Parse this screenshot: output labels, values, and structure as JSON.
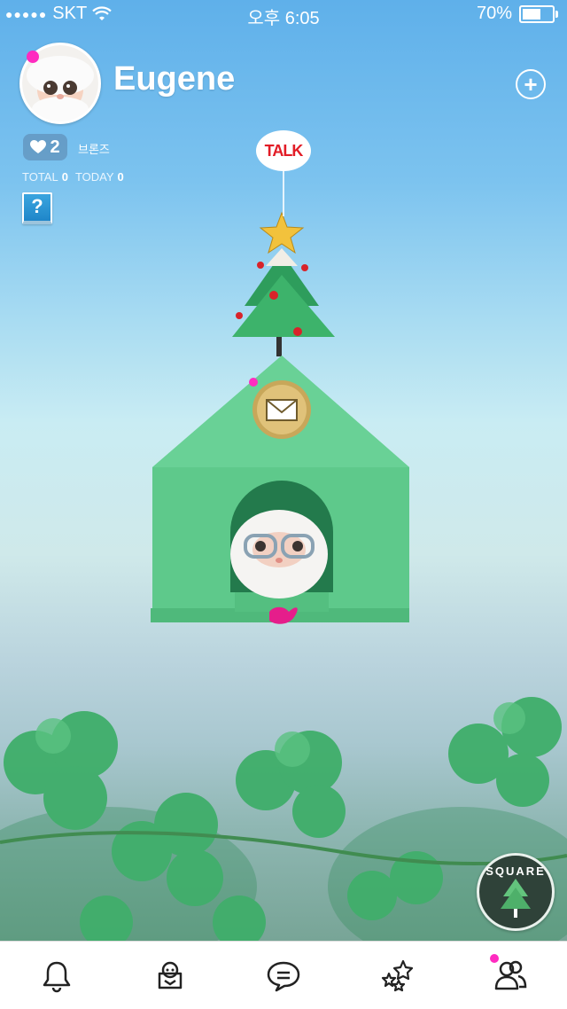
{
  "status_bar": {
    "carrier": "SKT",
    "time": "오후 6:05",
    "battery_percent": "70%",
    "battery_level": 0.7
  },
  "profile": {
    "name": "Eugene",
    "likes": "2",
    "grade": "브론즈",
    "total_label": "TOTAL",
    "total_value": "0",
    "today_label": "TODAY",
    "today_value": "0",
    "help_label": "?"
  },
  "scene": {
    "talk_label": "TALK",
    "square_label": "SQUARE"
  },
  "colors": {
    "accent_pink": "#ff2bc0",
    "house_green": "#5ec98b",
    "talk_red": "#e21c26"
  },
  "tabs": [
    {
      "icon": "bell-icon"
    },
    {
      "icon": "home-icon"
    },
    {
      "icon": "chat-icon"
    },
    {
      "icon": "stars-icon"
    },
    {
      "icon": "friends-icon"
    }
  ]
}
